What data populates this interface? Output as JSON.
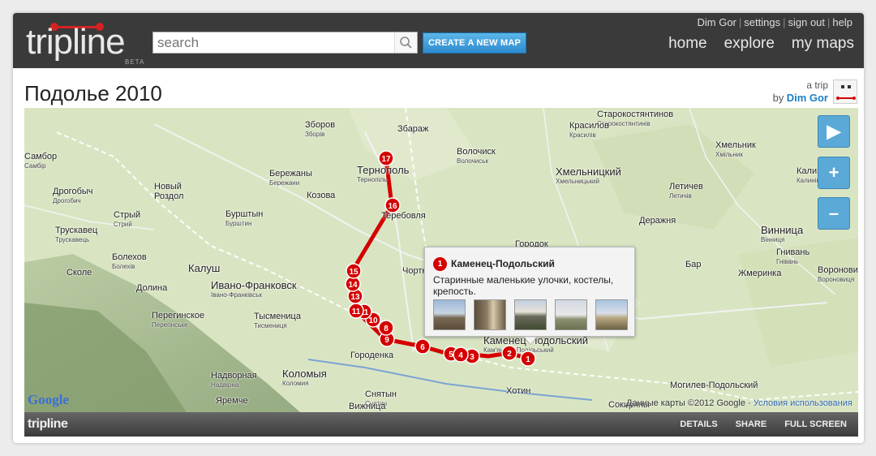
{
  "header": {
    "logo_text": "tripline",
    "logo_beta": "BETA",
    "search_placeholder": "search",
    "create_button": "CREATE A NEW MAP",
    "user_links": [
      "Dim Gor",
      "settings",
      "sign out",
      "help"
    ],
    "nav": [
      "home",
      "explore",
      "my maps"
    ]
  },
  "trip": {
    "title": "Подолье 2010",
    "kind": "a trip",
    "by": "by",
    "author": "Dim Gor"
  },
  "map": {
    "cities": [
      {
        "name": "Зборов",
        "sub": "Зборів"
      },
      {
        "name": "Збараж",
        "sub": ""
      },
      {
        "name": "Старокостянтинов",
        "sub": "Старокостянтинів"
      },
      {
        "name": "Красилов",
        "sub": "Красилів"
      },
      {
        "name": "Хмельник",
        "sub": "Хмільник"
      },
      {
        "name": "Самбор",
        "sub": "Самбір"
      },
      {
        "name": "Бережаны",
        "sub": "Бережани"
      },
      {
        "name": "Тернополь",
        "sub": "Тернопіль"
      },
      {
        "name": "Волочиск",
        "sub": "Волочиськ"
      },
      {
        "name": "Хмельницкий",
        "sub": "Хмельницький"
      },
      {
        "name": "Дрогобыч",
        "sub": "Дрогобич"
      },
      {
        "name": "Новый Роздол",
        "sub": ""
      },
      {
        "name": "Козова",
        "sub": ""
      },
      {
        "name": "Летичев",
        "sub": "Летичів"
      },
      {
        "name": "Калиновка",
        "sub": "Калинівка"
      },
      {
        "name": "Стрый",
        "sub": "Стрий"
      },
      {
        "name": "Бурштын",
        "sub": "Бурштин"
      },
      {
        "name": "Теребовля",
        "sub": ""
      },
      {
        "name": "Деражня",
        "sub": ""
      },
      {
        "name": "Трускавец",
        "sub": "Трускавець"
      },
      {
        "name": "Винница",
        "sub": "Вінниця"
      },
      {
        "name": "Городок",
        "sub": ""
      },
      {
        "name": "Болехов",
        "sub": "Болехів"
      },
      {
        "name": "Калуш",
        "sub": ""
      },
      {
        "name": "Бар",
        "sub": ""
      },
      {
        "name": "Гнивань",
        "sub": "Гнівань"
      },
      {
        "name": "Сколе",
        "sub": ""
      },
      {
        "name": "Долина",
        "sub": ""
      },
      {
        "name": "Ивано-Франковск",
        "sub": "Івано-Франківськ"
      },
      {
        "name": "Чортков",
        "sub": ""
      },
      {
        "name": "Жмеринка",
        "sub": ""
      },
      {
        "name": "Вороновица",
        "sub": "Вороновиця"
      },
      {
        "name": "Перегинское",
        "sub": "Перегінське"
      },
      {
        "name": "Тысменица",
        "sub": "Тисмениця"
      },
      {
        "name": "Каменец-Подольский",
        "sub": "Кам'янець-Подільський"
      },
      {
        "name": "Городенка",
        "sub": ""
      },
      {
        "name": "Надворная",
        "sub": "Надвірна"
      },
      {
        "name": "Коломыя",
        "sub": "Коломия"
      },
      {
        "name": "Снятын",
        "sub": "Снятин"
      },
      {
        "name": "Хотин",
        "sub": ""
      },
      {
        "name": "Могилев-Подольский",
        "sub": ""
      },
      {
        "name": "Яремче",
        "sub": ""
      },
      {
        "name": "Вижница",
        "sub": ""
      },
      {
        "name": "Сокиряны",
        "sub": ""
      }
    ],
    "stops": [
      "1",
      "2",
      "3",
      "4",
      "5",
      "6",
      "8",
      "9",
      "10",
      "11",
      "11",
      "13",
      "14",
      "15",
      "16",
      "17"
    ],
    "controls": [
      "▶",
      "+",
      "–"
    ],
    "google_logo": "Google",
    "copyright": "Данные карты ©2012 Google",
    "terms": "Условия использования"
  },
  "popup": {
    "number": "1",
    "title": "Каменец-Подольский",
    "description": "Старинные маленькие улочки, костелы, крепость."
  },
  "footer": {
    "logo": "tripline",
    "links": [
      "DETAILS",
      "SHARE",
      "FULL SCREEN"
    ]
  },
  "colors": {
    "header_bg": "#3a3a3a",
    "accent_blue": "#2d8bd0",
    "route_red": "#d40000",
    "map_land": "#d6e3bf"
  }
}
